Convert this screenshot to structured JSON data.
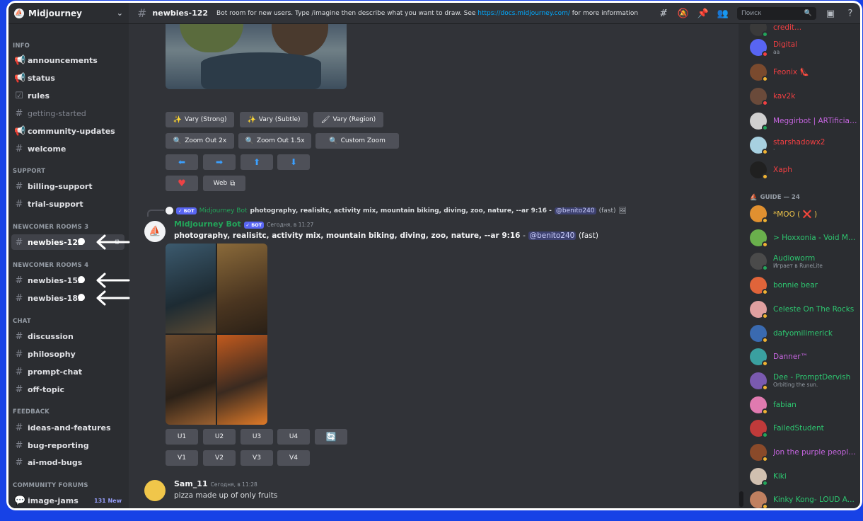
{
  "server": {
    "name": "Midjourney"
  },
  "sidebar": {
    "categories": {
      "info": "INFO",
      "support": "SUPPORT",
      "newcomer3": "NEWCOMER ROOMS 3",
      "newcomer4": "NEWCOMER ROOMS 4",
      "chat": "CHAT",
      "feedback": "FEEDBACK",
      "forums": "COMMUNITY FORUMS"
    },
    "channels": {
      "announcements": "announcements",
      "status": "status",
      "rules": "rules",
      "getting_started": "getting-started",
      "community_updates": "community-updates",
      "welcome": "welcome",
      "billing_support": "billing-support",
      "trial_support": "trial-support",
      "newbies_122": "newbies-122",
      "newbies_152": "newbies-152",
      "newbies_182": "newbies-182",
      "discussion": "discussion",
      "philosophy": "philosophy",
      "prompt_chat": "prompt-chat",
      "off_topic": "off-topic",
      "ideas": "ideas-and-features",
      "bug_reporting": "bug-reporting",
      "ai_mod_bugs": "ai-mod-bugs",
      "image_jams": "image-jams",
      "image_jams_badge": "131 New"
    }
  },
  "topbar": {
    "channel": "newbies-122",
    "topic_prefix": "Bot room for new users. Type /imagine then describe what you want to draw. See ",
    "topic_link": "https://docs.midjourney.com/",
    "topic_suffix": " for more information",
    "search_placeholder": "Поиск"
  },
  "upscale_buttons": {
    "vary_strong": "Vary (Strong)",
    "vary_subtle": "Vary (Subtle)",
    "vary_region": "Vary (Region)",
    "zoom_2x": "Zoom Out 2x",
    "zoom_15x": "Zoom Out 1.5x",
    "custom_zoom": "Custom Zoom",
    "web": "Web"
  },
  "reply": {
    "bot_tag": "✓ БОТ",
    "author": "Midjourney Bot",
    "text": "photography, realisitc, activity mix, mountain biking, diving, zoo, nature, --ar 9:16 -",
    "mention": "@benito240",
    "mode": "(fast)"
  },
  "bot_message": {
    "author": "Midjourney Bot",
    "tag": "✓ БОТ",
    "timestamp": "Сегодня, в 11:27",
    "prompt": "photography, realisitc, activity mix, mountain biking, diving, zoo, nature, --ar 9:16",
    "separator": "-",
    "mention": "@benito240",
    "mode": "(fast)",
    "buttons": {
      "u1": "U1",
      "u2": "U2",
      "u3": "U3",
      "u4": "U4",
      "v1": "V1",
      "v2": "V2",
      "v3": "V3",
      "v4": "V4"
    }
  },
  "user_message": {
    "author": "Sam_11",
    "timestamp": "Сегодня, в 11:28",
    "text": "pizza made up of only fruits"
  },
  "members": {
    "top_partial": "credit...",
    "list1": [
      {
        "name": "Digital",
        "sub": "aa",
        "color": "#f23f42",
        "av": "#5865f2",
        "status": "#f23f42"
      },
      {
        "name": "Feonix 👠",
        "sub": "",
        "color": "#f23f42",
        "av": "#7a4a2e",
        "status": "#f0b232"
      },
      {
        "name": "kav2k",
        "sub": "",
        "color": "#f23f42",
        "av": "#6a4a3a",
        "status": "#f23f42"
      },
      {
        "name": "Meggirbot | ARTificial...",
        "sub": "",
        "color": "#c665e0",
        "av": "#d0d0d0",
        "status": "#23a55a"
      },
      {
        "name": "starshadowx2",
        "sub": "·",
        "color": "#f23f42",
        "av": "#a7d0e0",
        "status": "#f0b232"
      },
      {
        "name": "Xaph",
        "sub": "",
        "color": "#f23f42",
        "av": "#202020",
        "status": "#f0b232"
      }
    ],
    "guide_header": "GUIDE — 24",
    "list2": [
      {
        "name": "*MOO ( ❌ )",
        "sub": "",
        "color": "#f0c64a",
        "av": "#e09030",
        "status": "#f0b232"
      },
      {
        "name": "> Hoxxonia - Void Ma...",
        "sub": "",
        "color": "#2dc770",
        "av": "#6ab04c",
        "status": "#f0b232"
      },
      {
        "name": "Audioworm",
        "sub": "Играет в RuneLite",
        "color": "#2dc770",
        "av": "#4a4a4a",
        "status": "#23a55a"
      },
      {
        "name": "bonnie bear",
        "sub": "",
        "color": "#2dc770",
        "av": "#e0643a",
        "status": "#f0b232"
      },
      {
        "name": "Celeste On The Rocks",
        "sub": "",
        "color": "#2dc770",
        "av": "#e0a0a0",
        "status": "#f0b232"
      },
      {
        "name": "dafyomilimerick",
        "sub": "",
        "color": "#2dc770",
        "av": "#3a6ab0",
        "status": "#f0b232"
      },
      {
        "name": "Danner™",
        "sub": "",
        "color": "#c665e0",
        "av": "#3aa0a0",
        "status": "#f0b232"
      },
      {
        "name": "Dee - PromptDervish",
        "sub": "Orbiting the sun.",
        "color": "#2dc770",
        "av": "#7a5ab0",
        "status": "#f0b232"
      },
      {
        "name": "fabian",
        "sub": "",
        "color": "#2dc770",
        "av": "#e07ab0",
        "status": "#f0b232"
      },
      {
        "name": "FailedStudent",
        "sub": "",
        "color": "#2dc770",
        "av": "#c03a3a",
        "status": "#23a55a"
      },
      {
        "name": "Jon the purple people...",
        "sub": "",
        "color": "#c665e0",
        "av": "#8a4a2a",
        "status": "#f0b232"
      },
      {
        "name": "Kiki",
        "sub": "",
        "color": "#2dc770",
        "av": "#d0c0b0",
        "status": "#23a55a"
      },
      {
        "name": "Kinky Kong- LOUD A...",
        "sub": "",
        "color": "#2dc770",
        "av": "#c08060",
        "status": "#f0b232"
      }
    ]
  }
}
